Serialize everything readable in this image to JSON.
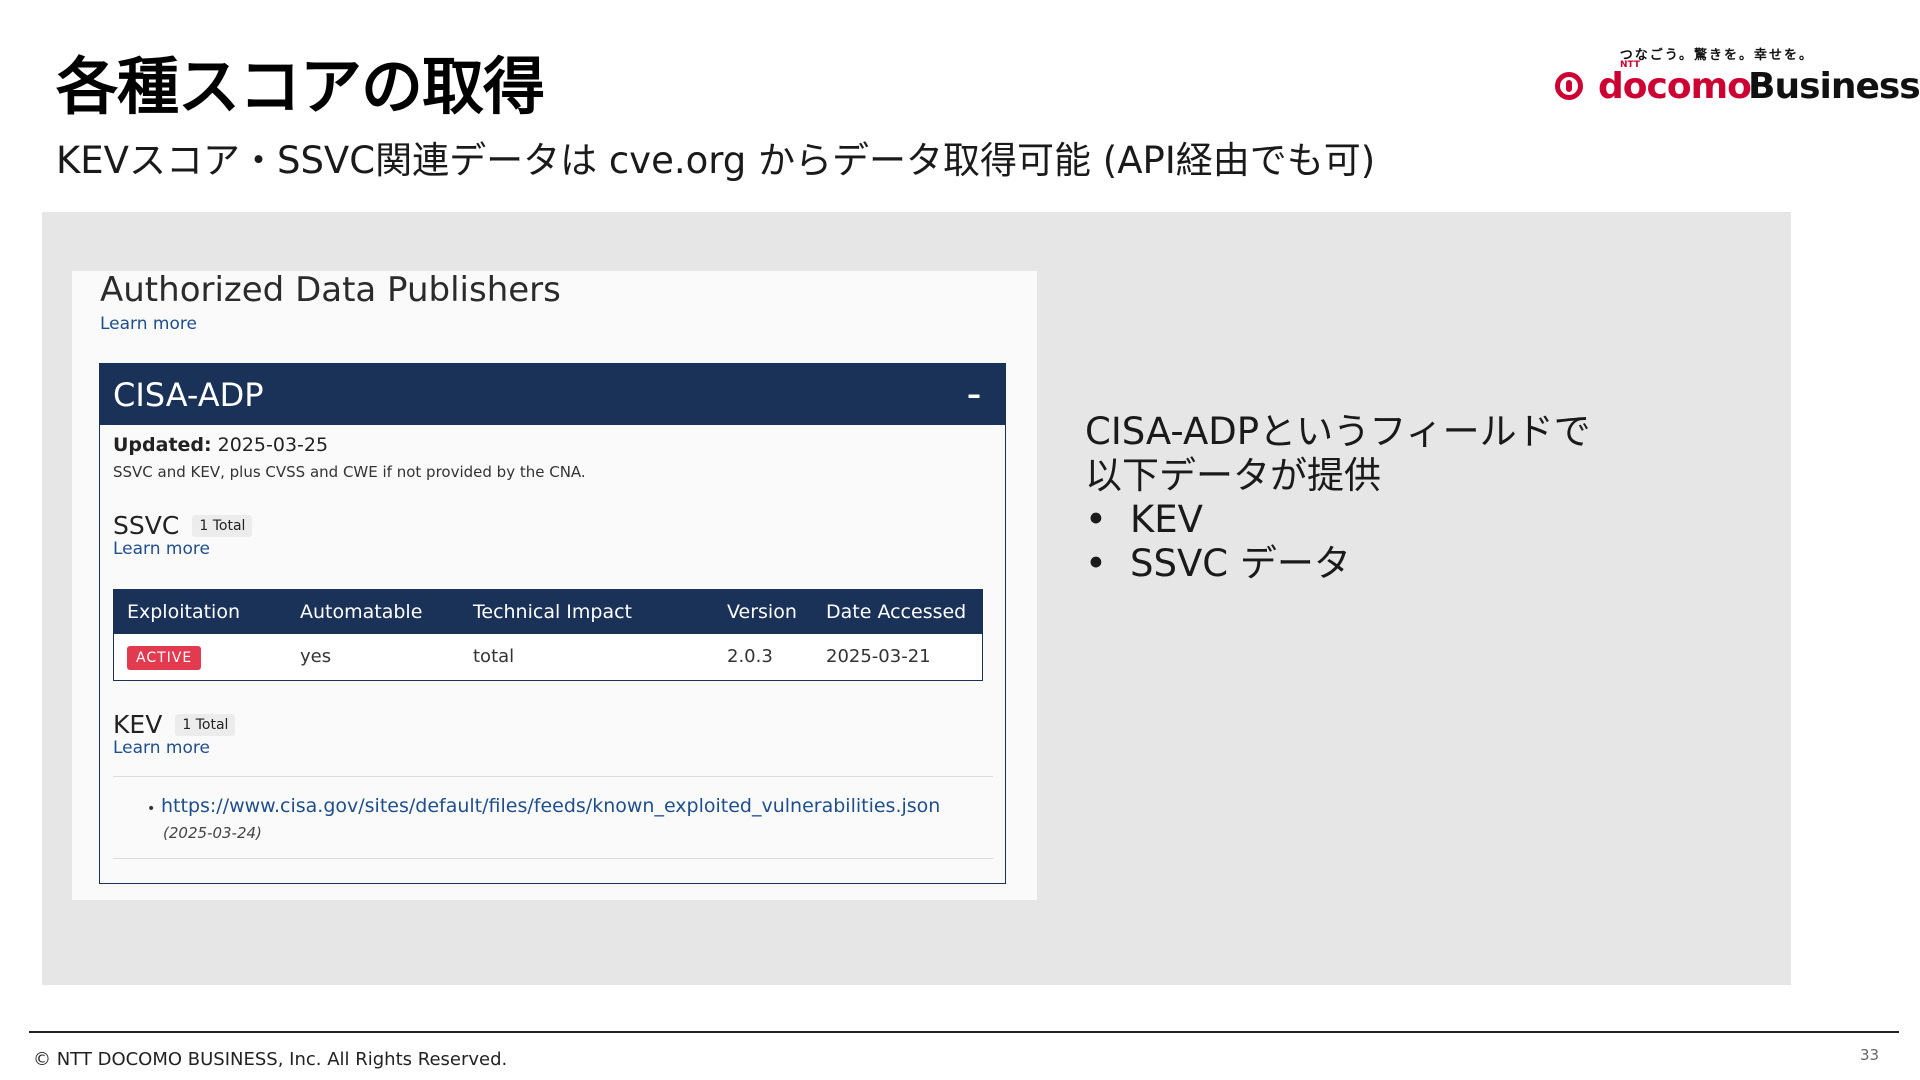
{
  "slide": {
    "title": "各種スコアの取得",
    "subtitle": "KEVスコア・SSVC関連データは cve.org からデータ取得可能 (API経由でも可)",
    "page_number": "33",
    "copyright": "© NTT DOCOMO BUSINESS, Inc. All Rights Reserved."
  },
  "logo": {
    "tagline": "つなごう。驚きを。幸せを。",
    "ntt": "NTT",
    "brand": "docomo",
    "business": "Business",
    "brand_color": "#cc0033"
  },
  "screenshot": {
    "heading": "Authorized Data Publishers",
    "learn_more": "Learn more",
    "card": {
      "title": "CISA-ADP",
      "collapse_symbol": "–",
      "updated_label": "Updated:",
      "updated_value": "2025-03-25",
      "description": "SSVC and KEV, plus CVSS and CWE if not provided by the CNA.",
      "header_color": "#1a3158",
      "ssvc": {
        "title": "SSVC",
        "badge": "1 Total",
        "learn_more": "Learn more",
        "columns": [
          "Exploitation",
          "Automatable",
          "Technical Impact",
          "Version",
          "Date Accessed"
        ],
        "row": {
          "exploitation": "ACTIVE",
          "automatable": "yes",
          "technical_impact": "total",
          "version": "2.0.3",
          "date_accessed": "2025-03-21"
        }
      },
      "kev": {
        "title": "KEV",
        "badge": "1 Total",
        "learn_more": "Learn more",
        "url": "https://www.cisa.gov/sites/default/files/feeds/known_exploited_vulnerabilities.json",
        "date": "(2025-03-24)"
      }
    }
  },
  "side_note": {
    "line1": "CISA-ADPというフィールドで",
    "line2": "以下データが提供",
    "bullets": [
      "KEV",
      "SSVC データ"
    ]
  }
}
